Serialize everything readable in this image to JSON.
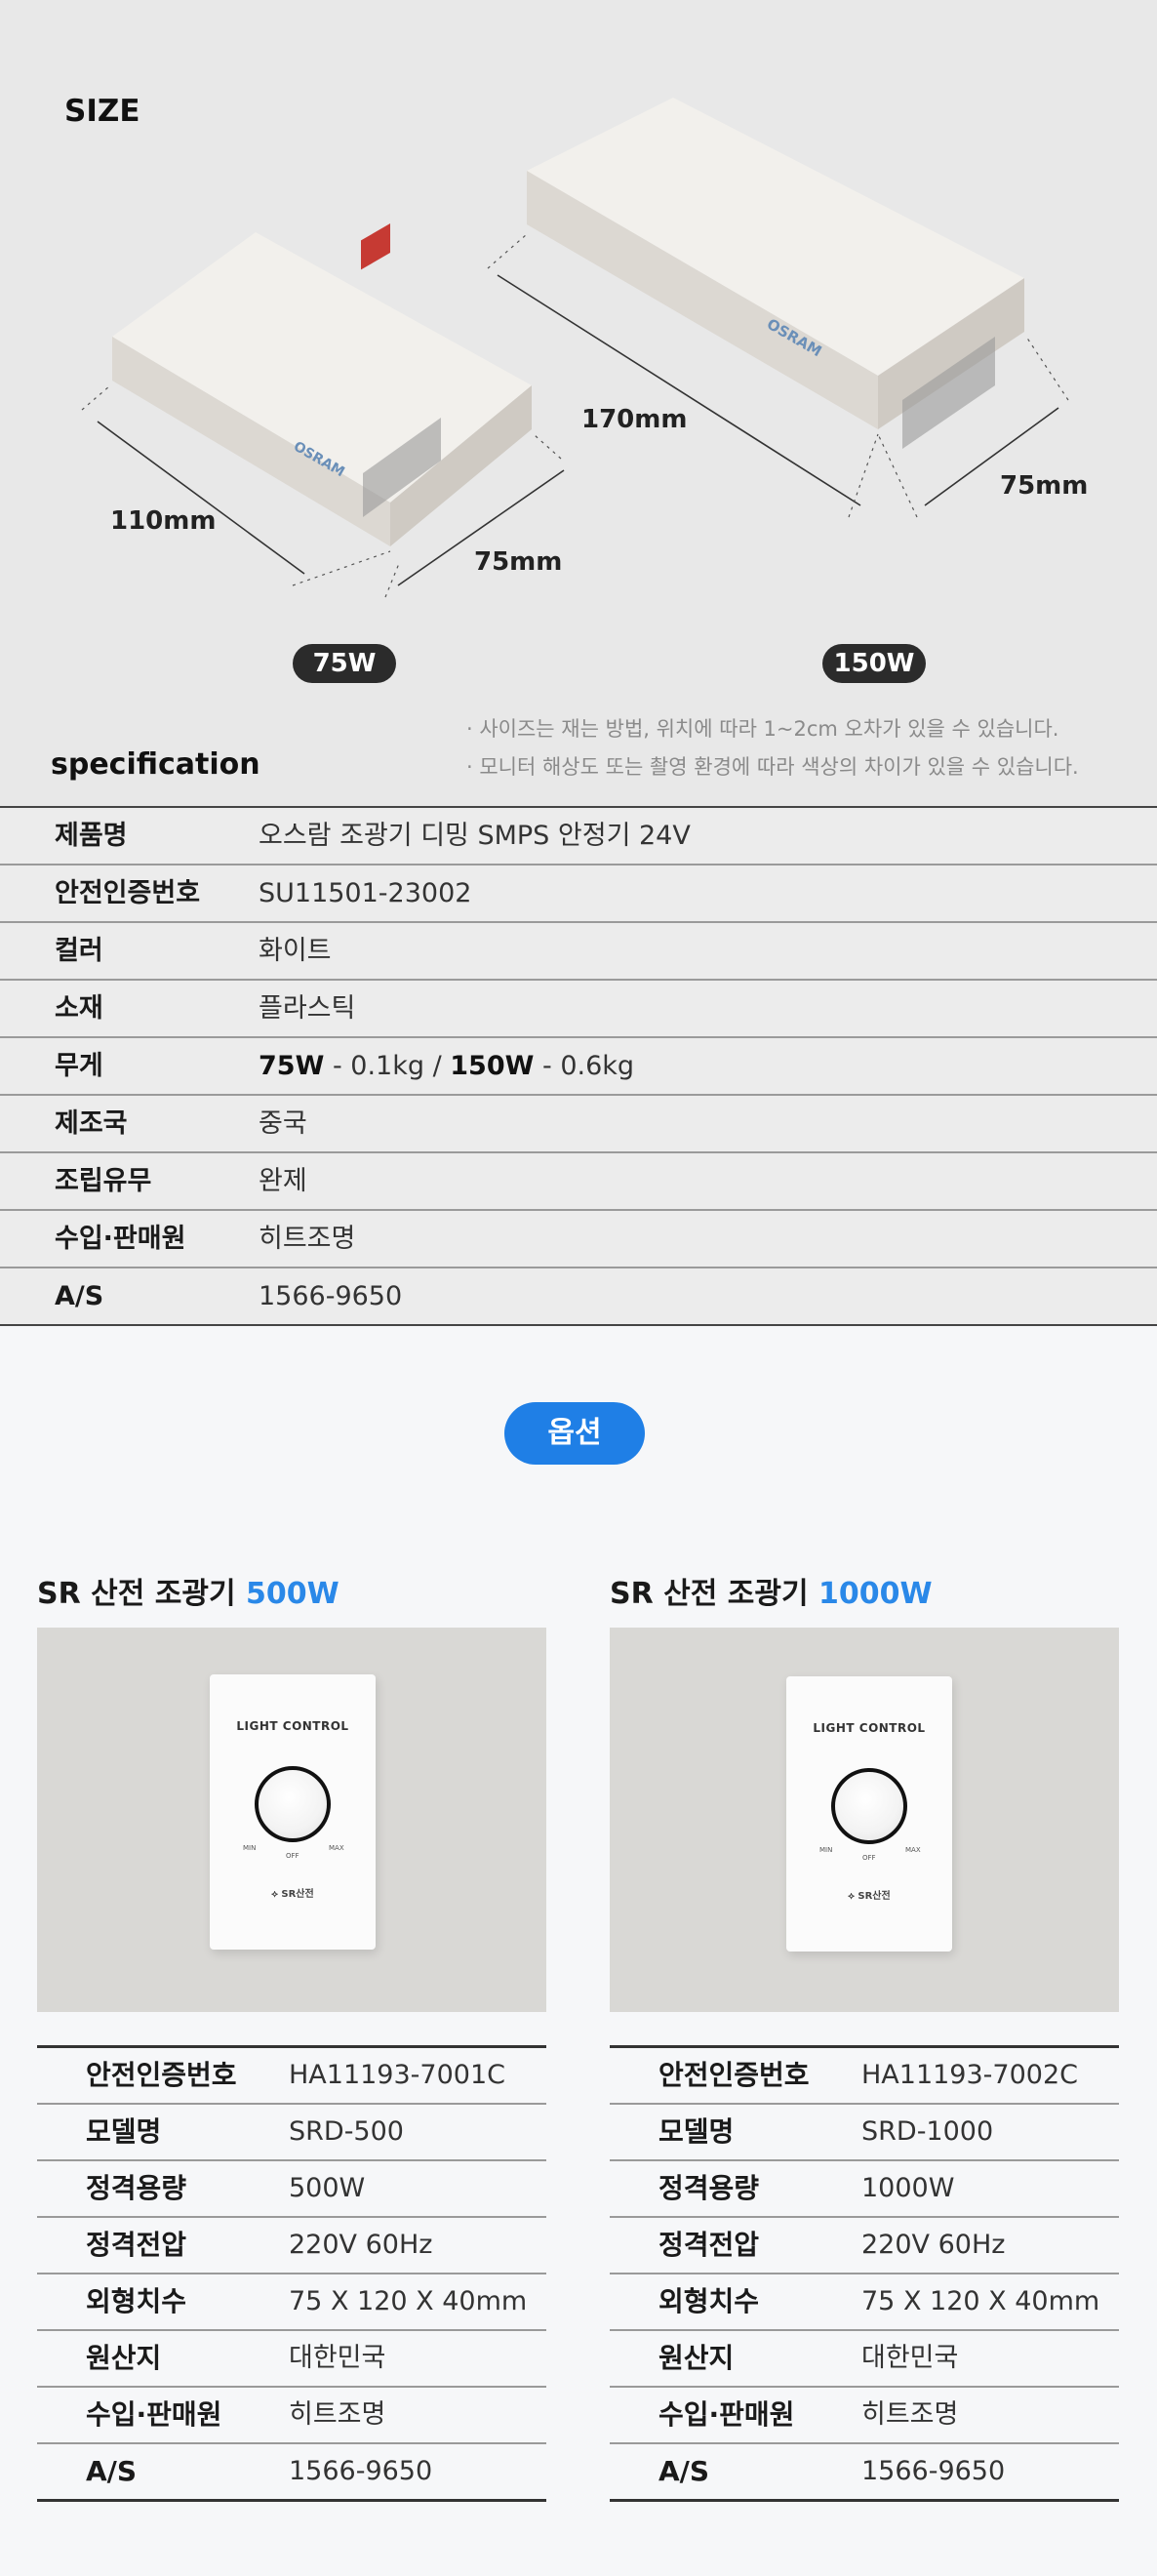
{
  "size_section": {
    "title": "SIZE",
    "dims_75w": {
      "length": "110mm",
      "width": "75mm",
      "badge": "75W"
    },
    "dims_150w": {
      "length": "170mm",
      "width": "75mm",
      "badge": "150W"
    },
    "notes": [
      "· 사이즈는 재는 방법, 위치에 따라 1~2cm 오차가 있을 수 있습니다.",
      "· 모니터 해상도 또는 촬영 환경에 따라 색상의 차이가 있을 수 있습니다."
    ],
    "spec_title": "specification"
  },
  "spec": {
    "rows": [
      {
        "key": "제품명",
        "value": "오스람 조광기 디밍 SMPS 안정기 24V"
      },
      {
        "key": "안전인증번호",
        "value": "SU11501-23002"
      },
      {
        "key": "컬러",
        "value": "화이트"
      },
      {
        "key": "소재",
        "value": "플라스틱"
      },
      {
        "key": "무게",
        "w1": "75W",
        "v1": " - 0.1kg / ",
        "w2": "150W",
        "v2": "  - 0.6kg"
      },
      {
        "key": "제조국",
        "value": "중국"
      },
      {
        "key": "조립유무",
        "value": "완제"
      },
      {
        "key": "수입·판매원",
        "value": "히트조명"
      },
      {
        "key": "A/S",
        "value": "1566-9650"
      }
    ]
  },
  "option_badge": "옵션",
  "products": [
    {
      "title_main": "SR 산전 조광기 ",
      "title_watt": "500W",
      "photo": {
        "panel_label": "LIGHT CONTROL",
        "min": "MIN",
        "max": "MAX",
        "off": "OFF",
        "brand": "⟡ SR산전"
      },
      "rows": [
        {
          "key": "안전인증번호",
          "value": "HA11193-7001C"
        },
        {
          "key": "모델명",
          "value": "SRD-500"
        },
        {
          "key": "정격용량",
          "value": "500W"
        },
        {
          "key": "정격전압",
          "value": "220V 60Hz"
        },
        {
          "key": "외형치수",
          "value": "75 X 120 X 40mm"
        },
        {
          "key": "원산지",
          "value": "대한민국"
        },
        {
          "key": "수입·판매원",
          "value": "히트조명"
        },
        {
          "key": "A/S",
          "value": "1566-9650"
        }
      ]
    },
    {
      "title_main": "SR 산전 조광기 ",
      "title_watt": "1000W",
      "photo": {
        "panel_label": "LIGHT CONTROL",
        "min": "MIN",
        "max": "MAX",
        "off": "OFF",
        "brand": "⟡ SR산전"
      },
      "rows": [
        {
          "key": "안전인증번호",
          "value": "HA11193-7002C"
        },
        {
          "key": "모델명",
          "value": "SRD-1000"
        },
        {
          "key": "정격용량",
          "value": "1000W"
        },
        {
          "key": "정격전압",
          "value": "220V 60Hz"
        },
        {
          "key": "외형치수",
          "value": "75 X 120 X 40mm"
        },
        {
          "key": "원산지",
          "value": "대한민국"
        },
        {
          "key": "수입·판매원",
          "value": "히트조명"
        },
        {
          "key": "A/S",
          "value": "1566-9650"
        }
      ]
    }
  ]
}
